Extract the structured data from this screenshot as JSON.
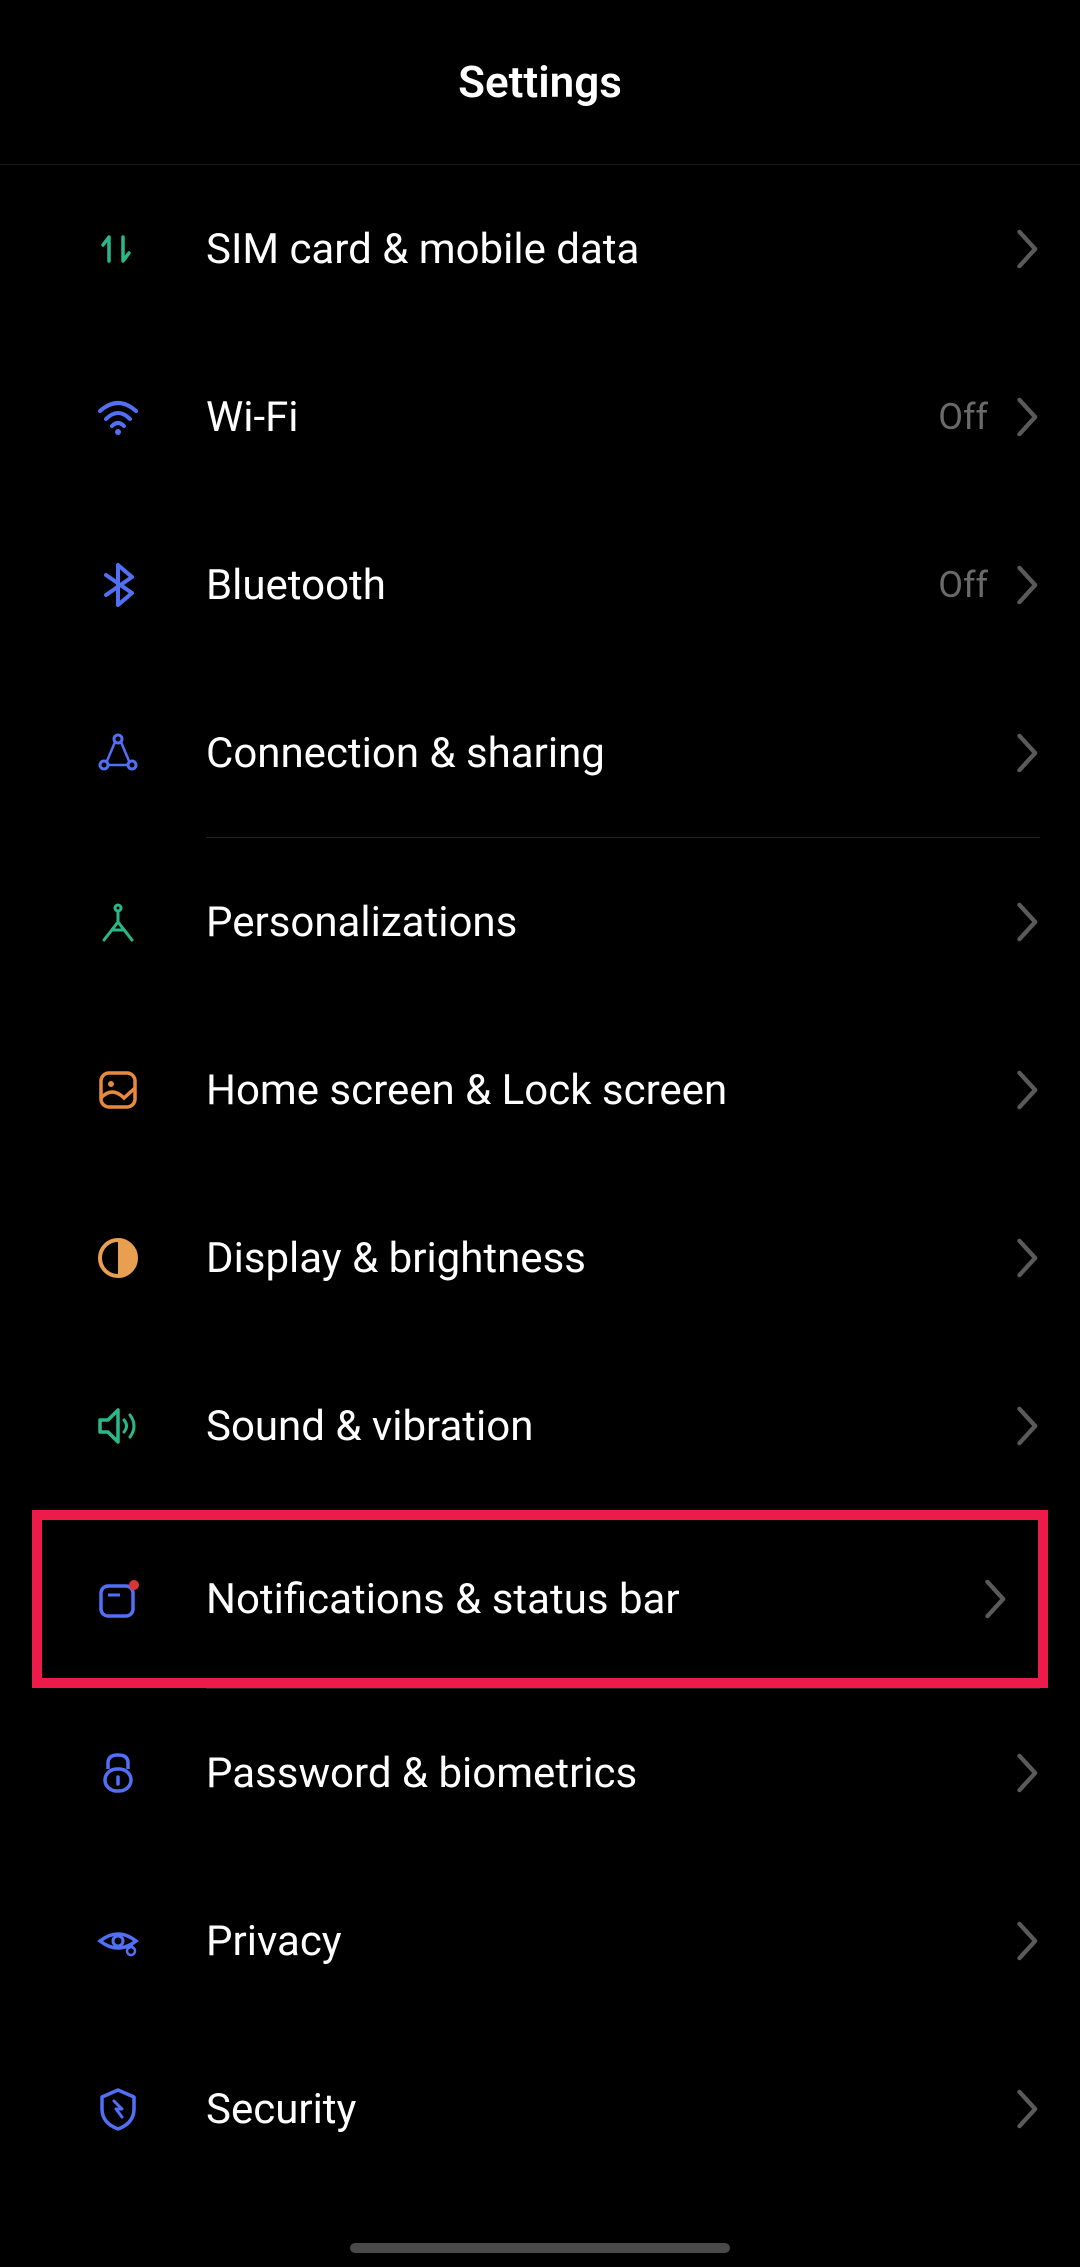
{
  "header": {
    "title": "Settings"
  },
  "items": [
    {
      "id": "sim-mobile-data",
      "label": "SIM card & mobile data",
      "value": "",
      "icon": "mobile-data-icon"
    },
    {
      "id": "wifi",
      "label": "Wi-Fi",
      "value": "Off",
      "icon": "wifi-icon"
    },
    {
      "id": "bluetooth",
      "label": "Bluetooth",
      "value": "Off",
      "icon": "bluetooth-icon"
    },
    {
      "id": "connection-sharing",
      "label": "Connection & sharing",
      "value": "",
      "icon": "sharing-icon"
    },
    {
      "id": "personalizations",
      "label": "Personalizations",
      "value": "",
      "icon": "compass-icon"
    },
    {
      "id": "home-lock-screen",
      "label": "Home screen & Lock screen",
      "value": "",
      "icon": "home-lock-icon"
    },
    {
      "id": "display-brightness",
      "label": "Display & brightness",
      "value": "",
      "icon": "brightness-icon"
    },
    {
      "id": "sound-vibration",
      "label": "Sound & vibration",
      "value": "",
      "icon": "sound-icon"
    },
    {
      "id": "notifications-status-bar",
      "label": "Notifications & status bar",
      "value": "",
      "icon": "notification-icon",
      "highlighted": true
    },
    {
      "id": "password-biometrics",
      "label": "Password & biometrics",
      "value": "",
      "icon": "lock-icon"
    },
    {
      "id": "privacy",
      "label": "Privacy",
      "value": "",
      "icon": "privacy-icon"
    },
    {
      "id": "security",
      "label": "Security",
      "value": "",
      "icon": "security-icon"
    }
  ],
  "colors": {
    "accent_green": "#2ab88a",
    "accent_blue": "#5170f5",
    "accent_orange": "#e78a3d",
    "muted": "#6a6a6a",
    "highlight": "#ed1b4a"
  }
}
